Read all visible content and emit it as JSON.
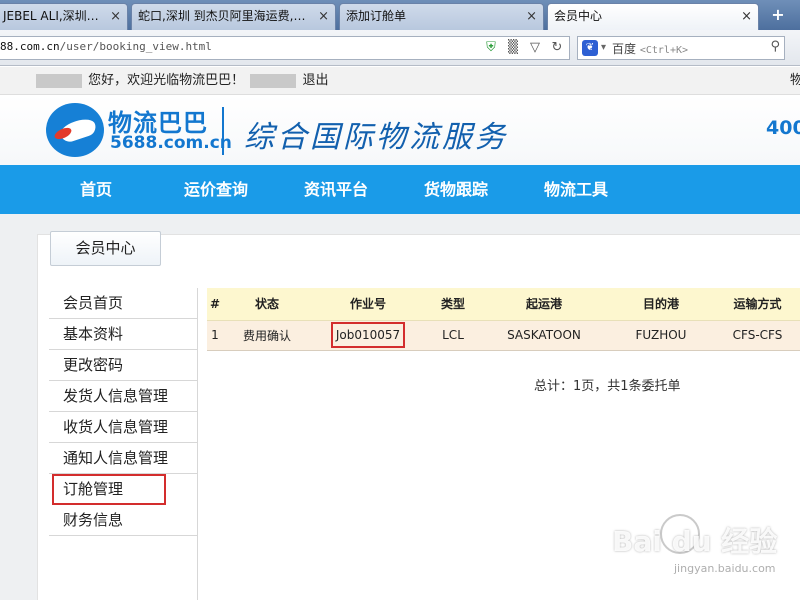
{
  "browser": {
    "tabs": [
      {
        "title": "JEBEL ALI,深圳…",
        "close": "×"
      },
      {
        "title": "蛇口,深圳 到杰贝阿里海运费,…",
        "close": "×"
      },
      {
        "title": "添加订舱单",
        "close": "×"
      },
      {
        "title": "会员中心",
        "close": "×"
      }
    ],
    "new_tab": "+",
    "url_host": "88.com.cn",
    "url_path": "/user/booking_view.html",
    "search_engine": "百度",
    "search_placeholder": "<Ctrl+K>"
  },
  "topbar": {
    "greeting": "您好，欢迎光临物流巴巴！",
    "logout": "退出",
    "right_text": "物"
  },
  "header": {
    "logo_cn": "物流巴巴",
    "logo_en": "5688.com.cn",
    "slogan": "综合国际物流服务",
    "hotline": "400"
  },
  "nav": [
    "首页",
    "运价查询",
    "资讯平台",
    "货物跟踪",
    "物流工具"
  ],
  "member_tab": "会员中心",
  "sidebar": [
    "会员首页",
    "基本资料",
    "更改密码",
    "发货人信息管理",
    "收货人信息管理",
    "通知人信息管理",
    "订舱管理",
    "财务信息"
  ],
  "table": {
    "headers": [
      "#",
      "状态",
      "作业号",
      "类型",
      "起运港",
      "目的港",
      "运输方式"
    ],
    "rows": [
      [
        "1",
        "费用确认",
        "Job010057",
        "LCL",
        "SASKATOON",
        "FUZHOU",
        "CFS-CFS"
      ]
    ]
  },
  "summary": "总计：1页，共1条委托单",
  "watermark": {
    "brand": "Bai du 经验",
    "url": "jingyan.baidu.com"
  },
  "colors": {
    "nav_blue": "#1a9be8",
    "logo_blue": "#1377cf",
    "highlight_red": "#d32d2d"
  }
}
